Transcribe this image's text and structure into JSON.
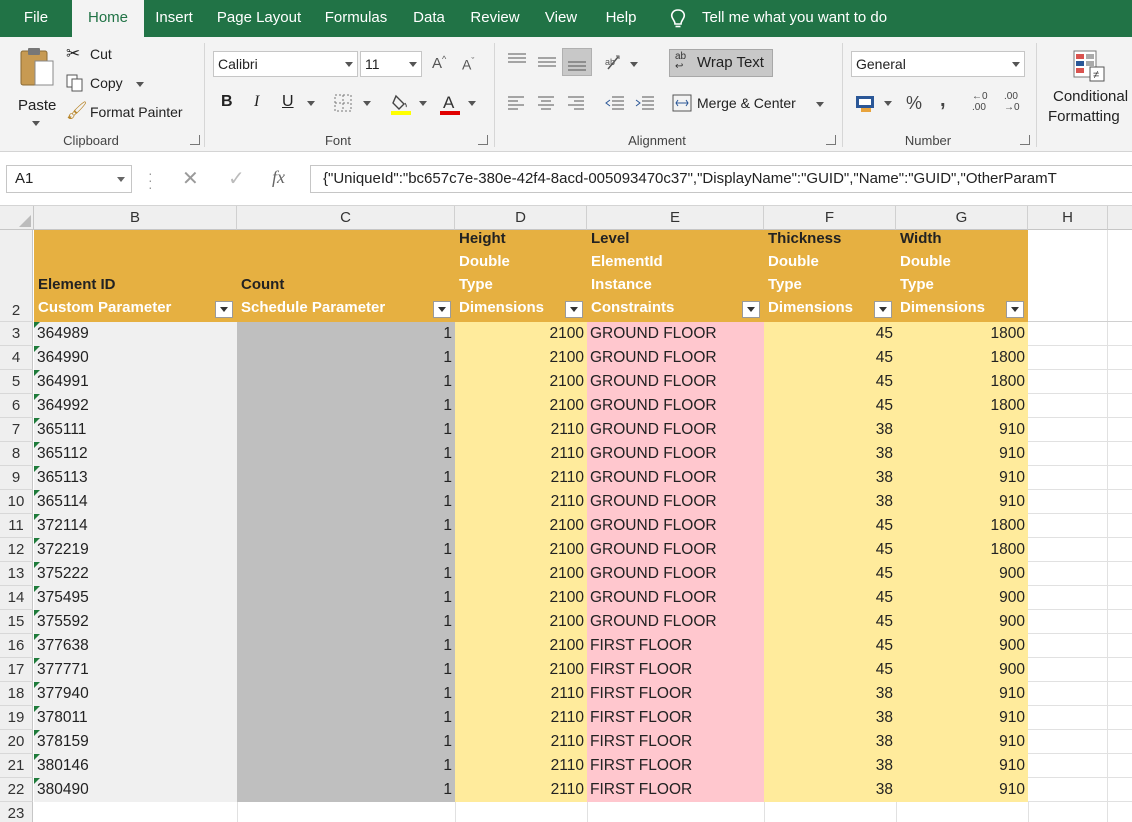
{
  "menu": {
    "tabs": [
      "File",
      "Home",
      "Insert",
      "Page Layout",
      "Formulas",
      "Data",
      "Review",
      "View",
      "Help"
    ],
    "active_tab": "Home",
    "tell_me": "Tell me what you want to do"
  },
  "ribbon": {
    "clipboard": {
      "paste": "Paste",
      "cut": "Cut",
      "copy": "Copy",
      "format_painter": "Format Painter",
      "group_label": "Clipboard"
    },
    "font": {
      "name": "Calibri",
      "size": "11",
      "bold": "B",
      "italic": "I",
      "underline": "U",
      "group_label": "Font"
    },
    "alignment": {
      "wrap_text": "Wrap Text",
      "merge_center": "Merge & Center",
      "group_label": "Alignment"
    },
    "number": {
      "format": "General",
      "percent": "%",
      "comma": ",",
      "group_label": "Number"
    },
    "styles": {
      "conditional_line1": "Conditional",
      "conditional_line2": "Formatting"
    }
  },
  "formula_bar": {
    "name_box": "A1",
    "fx": "fx",
    "content": "{\"UniqueId\":\"bc657c7e-380e-42f4-8acd-005093470c37\",\"DisplayName\":\"GUID\",\"Name\":\"GUID\",\"OtherParamT"
  },
  "columns": [
    "B",
    "C",
    "D",
    "E",
    "F",
    "G",
    "H"
  ],
  "header_row_number": "2",
  "headers": {
    "B": {
      "lines": [
        "Element ID"
      ],
      "sub": "Custom Parameter"
    },
    "C": {
      "lines": [
        "Count"
      ],
      "sub": "Schedule Parameter"
    },
    "D": {
      "lines": [
        "Height",
        "Double",
        "Type"
      ],
      "sub": "Dimensions"
    },
    "E": {
      "lines": [
        "Level",
        "ElementId",
        "Instance"
      ],
      "sub": "Constraints"
    },
    "F": {
      "lines": [
        "Thickness",
        "Double",
        "Type"
      ],
      "sub": "Dimensions"
    },
    "G": {
      "lines": [
        "Width",
        "Double",
        "Type"
      ],
      "sub": "Dimensions"
    }
  },
  "rows": [
    {
      "row": "3",
      "id": "364989",
      "count": "1",
      "height": "2100",
      "level": "GROUND FLOOR",
      "thickness": "45",
      "width": "1800"
    },
    {
      "row": "4",
      "id": "364990",
      "count": "1",
      "height": "2100",
      "level": "GROUND FLOOR",
      "thickness": "45",
      "width": "1800"
    },
    {
      "row": "5",
      "id": "364991",
      "count": "1",
      "height": "2100",
      "level": "GROUND FLOOR",
      "thickness": "45",
      "width": "1800"
    },
    {
      "row": "6",
      "id": "364992",
      "count": "1",
      "height": "2100",
      "level": "GROUND FLOOR",
      "thickness": "45",
      "width": "1800"
    },
    {
      "row": "7",
      "id": "365111",
      "count": "1",
      "height": "2110",
      "level": "GROUND FLOOR",
      "thickness": "38",
      "width": "910"
    },
    {
      "row": "8",
      "id": "365112",
      "count": "1",
      "height": "2110",
      "level": "GROUND FLOOR",
      "thickness": "38",
      "width": "910"
    },
    {
      "row": "9",
      "id": "365113",
      "count": "1",
      "height": "2110",
      "level": "GROUND FLOOR",
      "thickness": "38",
      "width": "910"
    },
    {
      "row": "10",
      "id": "365114",
      "count": "1",
      "height": "2110",
      "level": "GROUND FLOOR",
      "thickness": "38",
      "width": "910"
    },
    {
      "row": "11",
      "id": "372114",
      "count": "1",
      "height": "2100",
      "level": "GROUND FLOOR",
      "thickness": "45",
      "width": "1800"
    },
    {
      "row": "12",
      "id": "372219",
      "count": "1",
      "height": "2100",
      "level": "GROUND FLOOR",
      "thickness": "45",
      "width": "1800"
    },
    {
      "row": "13",
      "id": "375222",
      "count": "1",
      "height": "2100",
      "level": "GROUND FLOOR",
      "thickness": "45",
      "width": "900"
    },
    {
      "row": "14",
      "id": "375495",
      "count": "1",
      "height": "2100",
      "level": "GROUND FLOOR",
      "thickness": "45",
      "width": "900"
    },
    {
      "row": "15",
      "id": "375592",
      "count": "1",
      "height": "2100",
      "level": "GROUND FLOOR",
      "thickness": "45",
      "width": "900"
    },
    {
      "row": "16",
      "id": "377638",
      "count": "1",
      "height": "2100",
      "level": "FIRST FLOOR",
      "thickness": "45",
      "width": "900"
    },
    {
      "row": "17",
      "id": "377771",
      "count": "1",
      "height": "2100",
      "level": "FIRST FLOOR",
      "thickness": "45",
      "width": "900"
    },
    {
      "row": "18",
      "id": "377940",
      "count": "1",
      "height": "2110",
      "level": "FIRST FLOOR",
      "thickness": "38",
      "width": "910"
    },
    {
      "row": "19",
      "id": "378011",
      "count": "1",
      "height": "2110",
      "level": "FIRST FLOOR",
      "thickness": "38",
      "width": "910"
    },
    {
      "row": "20",
      "id": "378159",
      "count": "1",
      "height": "2110",
      "level": "FIRST FLOOR",
      "thickness": "38",
      "width": "910"
    },
    {
      "row": "21",
      "id": "380146",
      "count": "1",
      "height": "2110",
      "level": "FIRST FLOOR",
      "thickness": "38",
      "width": "910"
    },
    {
      "row": "22",
      "id": "380490",
      "count": "1",
      "height": "2110",
      "level": "FIRST FLOOR",
      "thickness": "38",
      "width": "910"
    }
  ],
  "trailing_row_number": "23",
  "colors": {
    "menu_bg": "#217346",
    "header_fill": "#e6b041",
    "id_fill": "#f0f0f0",
    "count_fill": "#bfbfbf",
    "yellow_fill": "#ffeb9c",
    "pink_fill": "#ffc7ce"
  }
}
